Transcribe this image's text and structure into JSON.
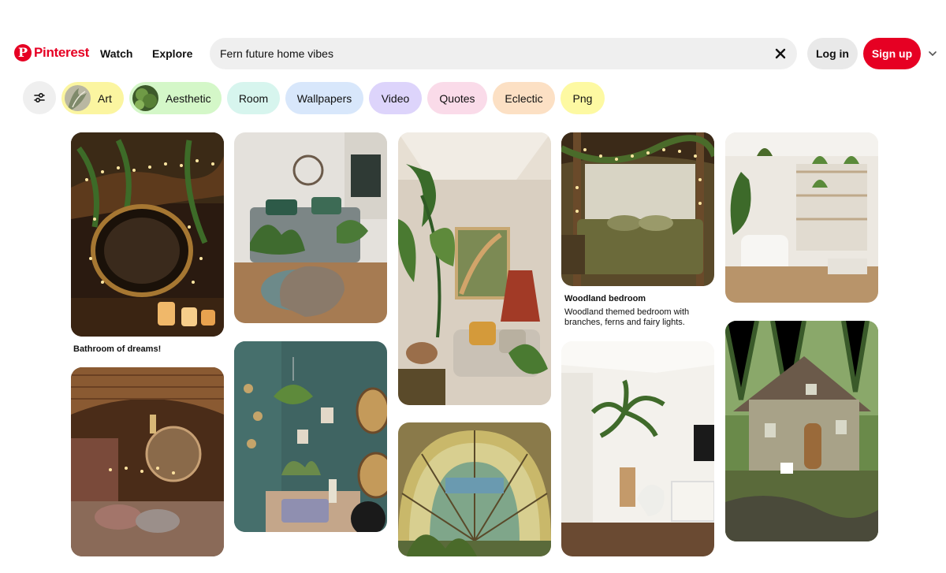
{
  "header": {
    "logo_text": "Pinterest",
    "logo_mark": "P",
    "nav": {
      "watch": "Watch",
      "explore": "Explore"
    },
    "search": {
      "value": "Fern future home vibes",
      "clear_icon": "close-icon"
    },
    "login_label": "Log in",
    "signup_label": "Sign up",
    "menu_icon": "chevron-down-icon"
  },
  "colors": {
    "brand": "#e60023"
  },
  "chips": {
    "filter_icon": "sliders-icon",
    "items": [
      {
        "label": "Art",
        "color": "#fbf5a0",
        "thumb": true
      },
      {
        "label": "Aesthetic",
        "color": "#d4f7c8",
        "thumb": true
      },
      {
        "label": "Room",
        "color": "#d7f5ee"
      },
      {
        "label": "Wallpapers",
        "color": "#d8e7fb"
      },
      {
        "label": "Video",
        "color": "#ddd4fb"
      },
      {
        "label": "Quotes",
        "color": "#fadbe9"
      },
      {
        "label": "Eclectic",
        "color": "#fce0c4"
      },
      {
        "label": "Png",
        "color": "#fdf9a2"
      }
    ]
  },
  "pins": [
    {
      "title": "Bathroom of dreams!"
    },
    {
      "title": "Woodland bedroom",
      "description": "Woodland themed bedroom with branches, ferns and fairy lights."
    }
  ]
}
